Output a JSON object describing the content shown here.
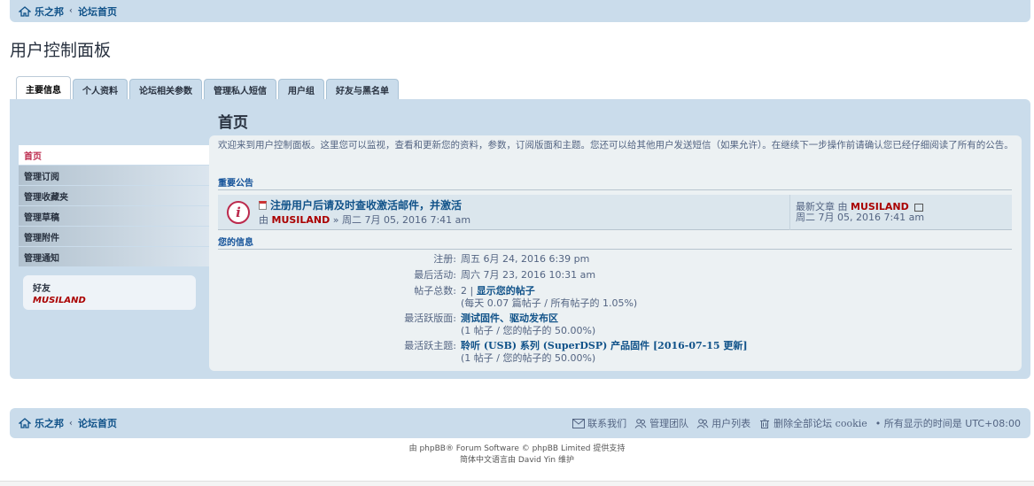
{
  "breadcrumb": {
    "home": "乐之邦",
    "forum_index": "论坛首页"
  },
  "page_title": "用户控制面板",
  "tabs": [
    {
      "label": "主要信息",
      "active": true
    },
    {
      "label": "个人资料",
      "active": false
    },
    {
      "label": "论坛相关参数",
      "active": false
    },
    {
      "label": "管理私人短信",
      "active": false
    },
    {
      "label": "用户组",
      "active": false
    },
    {
      "label": "好友与黑名单",
      "active": false
    }
  ],
  "sidebar": {
    "items": [
      {
        "label": "首页",
        "active": true
      },
      {
        "label": "管理订阅",
        "active": false
      },
      {
        "label": "管理收藏夹",
        "active": false
      },
      {
        "label": "管理草稿",
        "active": false
      },
      {
        "label": "管理附件",
        "active": false
      },
      {
        "label": "管理通知",
        "active": false
      }
    ],
    "friends_title": "好友",
    "friend_name": "MUSILAND"
  },
  "main": {
    "title": "首页",
    "intro": "欢迎来到用户控制面板。这里您可以监视，查看和更新您的资料，参数，订阅版面和主题。您还可以给其他用户发送短信（如果允许）。在继续下一步操作前请确认您已经仔细阅读了所有的公告。",
    "announcements_heading": "重要公告",
    "announcement": {
      "title": "注册用户后请及时查收激活邮件，并激活",
      "by_label": "由",
      "author": "MUSILAND",
      "sep": "»",
      "posted": "周二 7月 05, 2016 7:41 am",
      "last_post_label": "最新文章 由",
      "last_post_author": "MUSILAND",
      "last_post_time": "周二 7月 05, 2016 7:41 am"
    },
    "info_heading": "您的信息",
    "info": {
      "joined_label": "注册:",
      "joined": "周五 6月 24, 2016 6:39 pm",
      "last_active_label": "最后活动:",
      "last_active": "周六 7月 23, 2016 10:31 am",
      "posts_label": "帖子总数:",
      "posts_count": "2 |",
      "posts_link": "显示您的帖子",
      "posts_stats": "(每天 0.07 篇帖子 / 所有帖子的 1.05%)",
      "active_forum_label": "最活跃版面:",
      "active_forum": "测试固件、驱动发布区",
      "active_forum_stats": "(1 帖子 / 您的帖子的 50.00%)",
      "active_topic_label": "最活跃主题:",
      "active_topic": "聆听 (USB) 系列 (SuperDSP) 产品固件 [2016-07-15 更新]",
      "active_topic_stats": "(1 帖子 / 您的帖子的 50.00%)"
    }
  },
  "footer": {
    "home": "乐之邦",
    "forum_index": "论坛首页",
    "contact": "联系我们",
    "team": "管理团队",
    "members": "用户列表",
    "delete_cookies": "删除全部论坛 cookie",
    "timezone": "• 所有显示的时间是 UTC+08:00"
  },
  "copyright": {
    "line1": "由 phpBB® Forum Software © phpBB Limited 提供支持",
    "line2": "简体中文语言由 David Yin 维护"
  }
}
